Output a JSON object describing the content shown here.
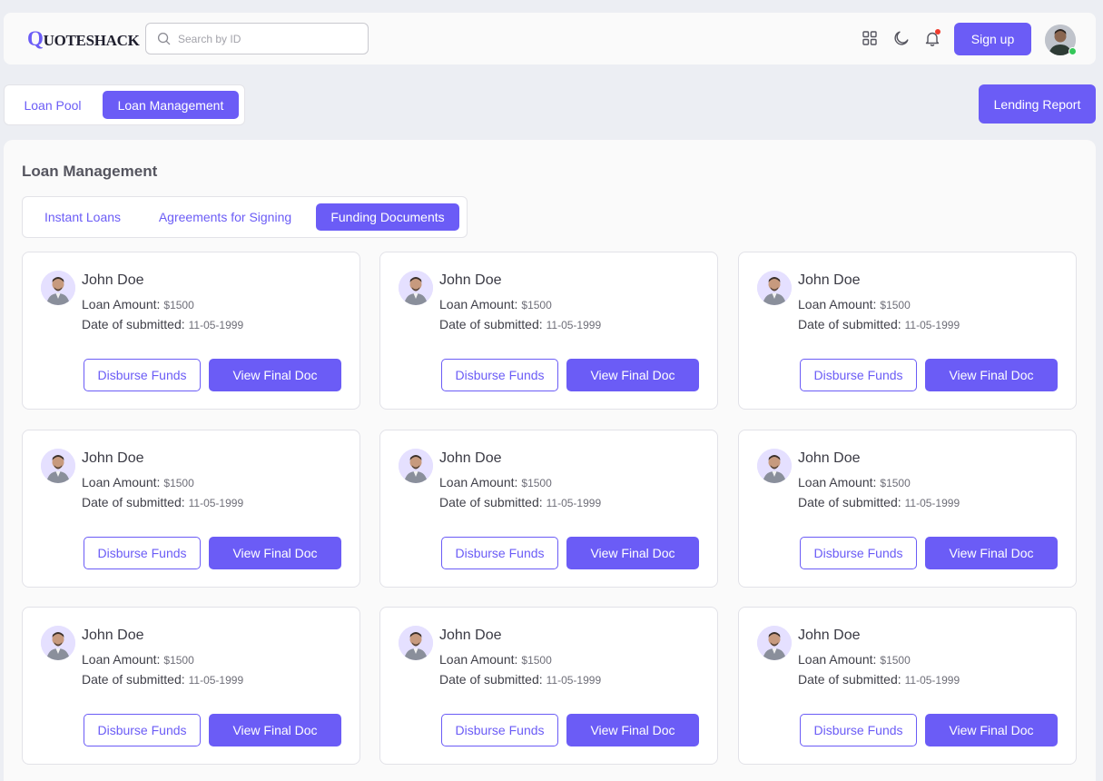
{
  "header": {
    "logo_initial": "Q",
    "logo_rest": "UOTESHACK",
    "search_placeholder": "Search by ID",
    "signup_label": "Sign up"
  },
  "top_tabs": [
    {
      "label": "Loan Pool",
      "active": false
    },
    {
      "label": "Loan Management",
      "active": true
    }
  ],
  "lending_report_label": "Lending Report",
  "panel": {
    "title": "Loan Management",
    "sub_tabs": [
      {
        "label": "Instant Loans",
        "active": false
      },
      {
        "label": "Agreements for Signing",
        "active": false
      },
      {
        "label": "Funding Documents",
        "active": true
      }
    ]
  },
  "cards": [
    {
      "name": "John Doe",
      "amount_label": "Loan Amount:",
      "amount": "$1500",
      "date_label": "Date of submitted:",
      "date": "11-05-1999",
      "btn_disburse": "Disburse Funds",
      "btn_view": "View Final Doc"
    },
    {
      "name": "John Doe",
      "amount_label": "Loan Amount:",
      "amount": "$1500",
      "date_label": "Date of submitted:",
      "date": "11-05-1999",
      "btn_disburse": "Disburse Funds",
      "btn_view": "View Final Doc"
    },
    {
      "name": "John Doe",
      "amount_label": "Loan Amount:",
      "amount": "$1500",
      "date_label": "Date of submitted:",
      "date": "11-05-1999",
      "btn_disburse": "Disburse Funds",
      "btn_view": "View Final Doc"
    },
    {
      "name": "John Doe",
      "amount_label": "Loan Amount:",
      "amount": "$1500",
      "date_label": "Date of submitted:",
      "date": "11-05-1999",
      "btn_disburse": "Disburse Funds",
      "btn_view": "View Final Doc"
    },
    {
      "name": "John Doe",
      "amount_label": "Loan Amount:",
      "amount": "$1500",
      "date_label": "Date of submitted:",
      "date": "11-05-1999",
      "btn_disburse": "Disburse Funds",
      "btn_view": "View Final Doc"
    },
    {
      "name": "John Doe",
      "amount_label": "Loan Amount:",
      "amount": "$1500",
      "date_label": "Date of submitted:",
      "date": "11-05-1999",
      "btn_disburse": "Disburse Funds",
      "btn_view": "View Final Doc"
    },
    {
      "name": "John Doe",
      "amount_label": "Loan Amount:",
      "amount": "$1500",
      "date_label": "Date of submitted:",
      "date": "11-05-1999",
      "btn_disburse": "Disburse Funds",
      "btn_view": "View Final Doc"
    },
    {
      "name": "John Doe",
      "amount_label": "Loan Amount:",
      "amount": "$1500",
      "date_label": "Date of submitted:",
      "date": "11-05-1999",
      "btn_disburse": "Disburse Funds",
      "btn_view": "View Final Doc"
    },
    {
      "name": "John Doe",
      "amount_label": "Loan Amount:",
      "amount": "$1500",
      "date_label": "Date of submitted:",
      "date": "11-05-1999",
      "btn_disburse": "Disburse Funds",
      "btn_view": "View Final Doc"
    }
  ],
  "icons": {
    "search": "search-icon",
    "grid": "grid-icon",
    "theme": "moon-icon",
    "notifications": "bell-icon",
    "profile": "avatar"
  },
  "colors": {
    "accent": "#6b5cf6",
    "background": "#eceef3",
    "notification_dot": "#ef3b2d",
    "online": "#34c759"
  }
}
